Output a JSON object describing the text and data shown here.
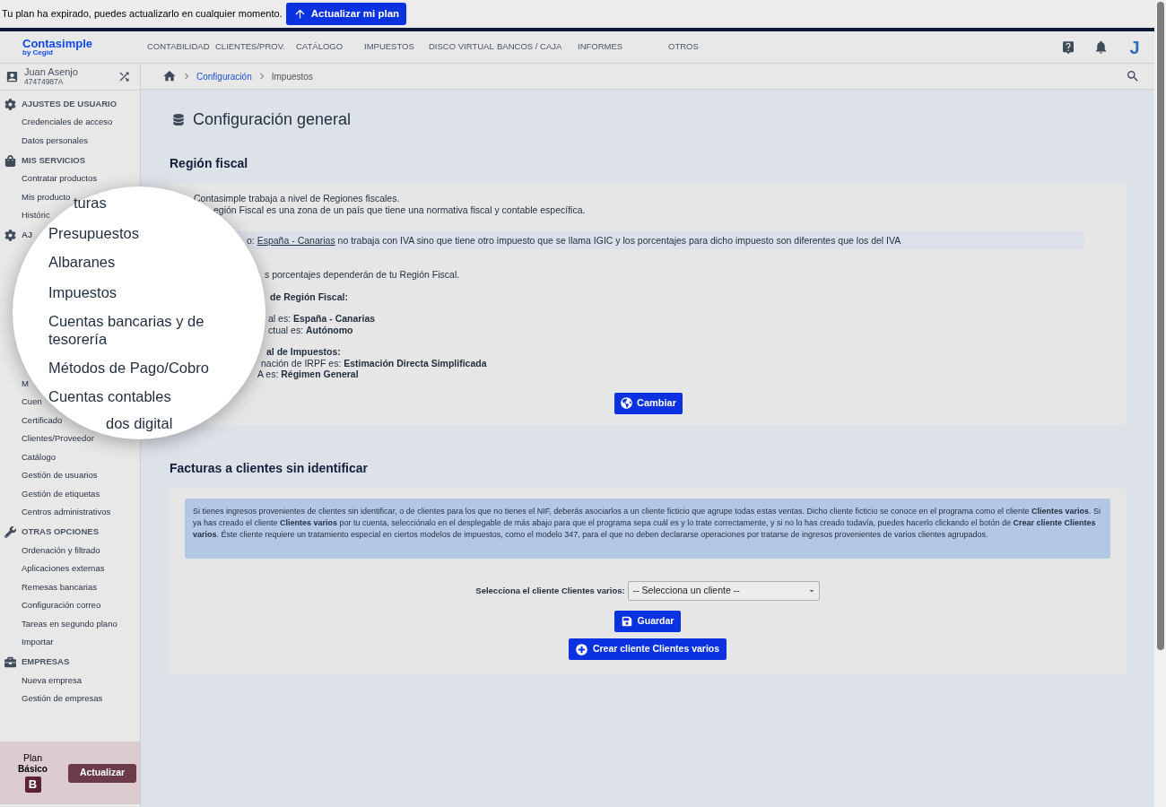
{
  "banner": {
    "text": "Tu plan ha expirado, puedes actualizarlo en cualquier momento.",
    "button": "Actualizar mi plan"
  },
  "logo": {
    "name": "Contasimple",
    "sub": "by Cegid"
  },
  "nav": [
    "CONTABILIDAD",
    "CLIENTES/PROV.",
    "CATÁLOGO",
    "IMPUESTOS",
    "DISCO VIRTUAL",
    "BANCOS / CAJA",
    "INFORMES",
    "OTROS"
  ],
  "avatar": "J",
  "user": {
    "name": "Juan Asenjo",
    "id": "47474987A"
  },
  "breadcrumb": [
    {
      "label": "Configuración",
      "kind": "link"
    },
    {
      "label": "Impuestos",
      "kind": "current"
    }
  ],
  "sidebar": [
    {
      "title": "AJUSTES DE USUARIO",
      "items": [
        "Credenciales de acceso",
        "Datos personales"
      ]
    },
    {
      "title": "MIS SERVICIOS",
      "items": [
        "Contratar productos",
        "Mis producto",
        "Históric"
      ]
    },
    {
      "title": "AJ",
      "items": [
        "M",
        "Cuen",
        "Certificado",
        "Clientes/Proveedor",
        "Catálogo",
        "Gestión de usuarios",
        "Gestión de etiquetas",
        "Centros administrativos"
      ]
    },
    {
      "title": "OTRAS OPCIONES",
      "items": [
        "Ordenación y filtrado",
        "Aplicaciones externas",
        "Remesas bancarias",
        "Configuración correo",
        "Tareas en segundo plano",
        "Importar"
      ]
    },
    {
      "title": "EMPRESAS",
      "items": [
        "Nueva empresa",
        "Gestión de empresas"
      ]
    }
  ],
  "plan": {
    "label": "Plan",
    "name": "Básico",
    "letter": "B",
    "button": "Actualizar"
  },
  "magnifier": [
    "turas",
    "Presupuestos",
    "Albaranes",
    "Impuestos",
    "Cuentas bancarias y de tesorería",
    "Métodos de Pago/Cobro",
    "Cuentas contables",
    "dos digital"
  ],
  "page_title": "Configuración general",
  "region": {
    "title": "Región fiscal",
    "intro": [
      "Contasimple trabaja a nivel de Regiones fiscales.",
      "egión Fiscal es una zona de un país que tiene una normativa fiscal y contable específica."
    ],
    "note": {
      "prefix": "o: ",
      "link": "España - Canarias",
      "rest": " no trabaja con IVA sino que tiene otro impuesto que se llama IGIC y los porcentajes para dicho impuesto son diferentes que los del IVA"
    },
    "details": [
      {
        "kind": "text",
        "text": "s porcentajes dependerán de tu Región Fiscal."
      },
      {
        "kind": "heading",
        "text": "de Región Fiscal:"
      },
      {
        "kind": "text",
        "text": "al es: **España - Canarias**"
      },
      {
        "kind": "text",
        "text": "ctual es: **Autónomo**"
      },
      {
        "kind": "heading",
        "text": "al de Impuestos:"
      },
      {
        "kind": "text",
        "text": "nación de IRPF es: **Estimación Directa Simplificada**"
      },
      {
        "kind": "text",
        "text": "A es: **Régimen General**"
      }
    ],
    "button": "Cambiar"
  },
  "clients": {
    "title": "Facturas a clientes sin identificar",
    "info": "Si tienes ingresos provenientes de clientes sin identificar, o de clientes para los que no tienes el NIF, deberás asociarlos a un cliente ficticio que agrupe todas estas ventas. Dicho cliente ficticio se conoce en el programa como el cliente **Clientes varios**. Si ya has creado el cliente **Clientes varios** por tu cuenta, selecciónalo en el desplegable de más abajo para que el programa sepa cuál es y lo trate correctamente, y si no lo has creado todavía, puedes hacerlo clickando el botón de **Crear cliente Clientes varios**. Éste cliente requiere un tratamiento especial en ciertos modelos de impuestos, como el modelo 347, para el que no deben declararse operaciones por tratarse de ingresos provenientes de varios clientes agrupados.",
    "select_label": "Selecciona el cliente Clientes varios:",
    "select_value": "-- Selecciona un cliente --",
    "save": "Guardar",
    "create": "Crear cliente Clientes varios"
  }
}
